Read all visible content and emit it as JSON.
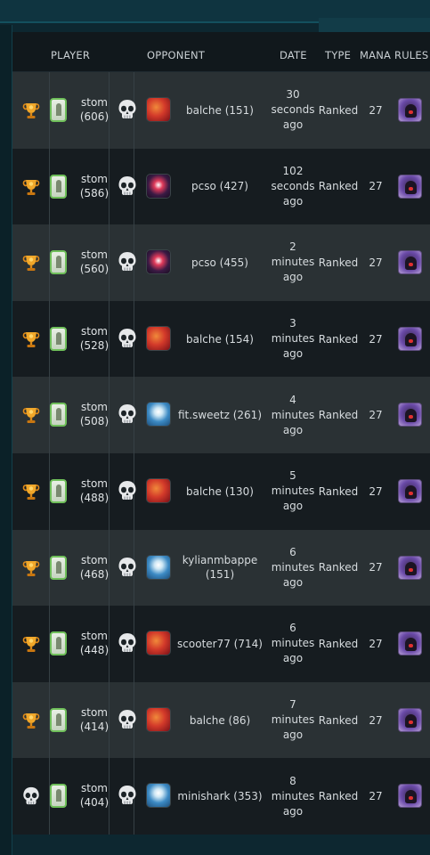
{
  "header": {
    "player": "PLAYER",
    "opponent": "OPPONENT",
    "date": "DATE",
    "type": "TYPE",
    "mana": "MANA",
    "rules": "RULES"
  },
  "colors": {
    "row_light": "#2a3134",
    "row_dark": "#161c20",
    "background": "#0d2730"
  },
  "rows": [
    {
      "result_icon": "trophy-icon",
      "player": "stom",
      "player_rating": "(606)",
      "opponent_result_icon": "skull-icon",
      "opponent_avatar": "red-dragon-avatar",
      "opponent": "balche (151)",
      "date_lines": [
        "30",
        "seconds",
        "ago"
      ],
      "type": "Ranked",
      "mana": "27",
      "rule_icon": "hooded-figure-rule-icon"
    },
    {
      "result_icon": "trophy-icon",
      "player": "stom",
      "player_rating": "(586)",
      "opponent_result_icon": "skull-icon",
      "opponent_avatar": "dark-creature-avatar",
      "opponent": "pcso (427)",
      "date_lines": [
        "102",
        "seconds",
        "ago"
      ],
      "type": "Ranked",
      "mana": "27",
      "rule_icon": "hooded-figure-rule-icon"
    },
    {
      "result_icon": "trophy-icon",
      "player": "stom",
      "player_rating": "(560)",
      "opponent_result_icon": "skull-icon",
      "opponent_avatar": "dark-creature-avatar",
      "opponent": "pcso (455)",
      "date_lines": [
        "2",
        "minutes",
        "ago"
      ],
      "type": "Ranked",
      "mana": "27",
      "rule_icon": "hooded-figure-rule-icon"
    },
    {
      "result_icon": "trophy-icon",
      "player": "stom",
      "player_rating": "(528)",
      "opponent_result_icon": "skull-icon",
      "opponent_avatar": "red-dragon-avatar",
      "opponent": "balche (154)",
      "date_lines": [
        "3",
        "minutes",
        "ago"
      ],
      "type": "Ranked",
      "mana": "27",
      "rule_icon": "hooded-figure-rule-icon"
    },
    {
      "result_icon": "trophy-icon",
      "player": "stom",
      "player_rating": "(508)",
      "opponent_result_icon": "skull-icon",
      "opponent_avatar": "blue-wizard-avatar",
      "opponent": "fit.sweetz (261)",
      "date_lines": [
        "4",
        "minutes",
        "ago"
      ],
      "type": "Ranked",
      "mana": "27",
      "rule_icon": "hooded-figure-rule-icon"
    },
    {
      "result_icon": "trophy-icon",
      "player": "stom",
      "player_rating": "(488)",
      "opponent_result_icon": "skull-icon",
      "opponent_avatar": "red-dragon-avatar",
      "opponent": "balche (130)",
      "date_lines": [
        "5",
        "minutes",
        "ago"
      ],
      "type": "Ranked",
      "mana": "27",
      "rule_icon": "hooded-figure-rule-icon"
    },
    {
      "result_icon": "trophy-icon",
      "player": "stom",
      "player_rating": "(468)",
      "opponent_result_icon": "skull-icon",
      "opponent_avatar": "blue-wizard-avatar",
      "opponent": "kylianmbappe (151)",
      "date_lines": [
        "6",
        "minutes",
        "ago"
      ],
      "type": "Ranked",
      "mana": "27",
      "rule_icon": "hooded-figure-rule-icon"
    },
    {
      "result_icon": "trophy-icon",
      "player": "stom",
      "player_rating": "(448)",
      "opponent_result_icon": "skull-icon",
      "opponent_avatar": "red-dragon-avatar",
      "opponent": "scooter77 (714)",
      "date_lines": [
        "6",
        "minutes",
        "ago"
      ],
      "type": "Ranked",
      "mana": "27",
      "rule_icon": "hooded-figure-rule-icon"
    },
    {
      "result_icon": "trophy-icon",
      "player": "stom",
      "player_rating": "(414)",
      "opponent_result_icon": "skull-icon",
      "opponent_avatar": "red-dragon-avatar",
      "opponent": "balche (86)",
      "date_lines": [
        "7",
        "minutes",
        "ago"
      ],
      "type": "Ranked",
      "mana": "27",
      "rule_icon": "hooded-figure-rule-icon"
    },
    {
      "result_icon": "skull-icon",
      "player": "stom",
      "player_rating": "(404)",
      "opponent_result_icon": "skull-icon",
      "opponent_avatar": "blue-wizard-avatar",
      "opponent": "minishark (353)",
      "date_lines": [
        "8",
        "minutes",
        "ago"
      ],
      "type": "Ranked",
      "mana": "27",
      "rule_icon": "hooded-figure-rule-icon"
    }
  ]
}
